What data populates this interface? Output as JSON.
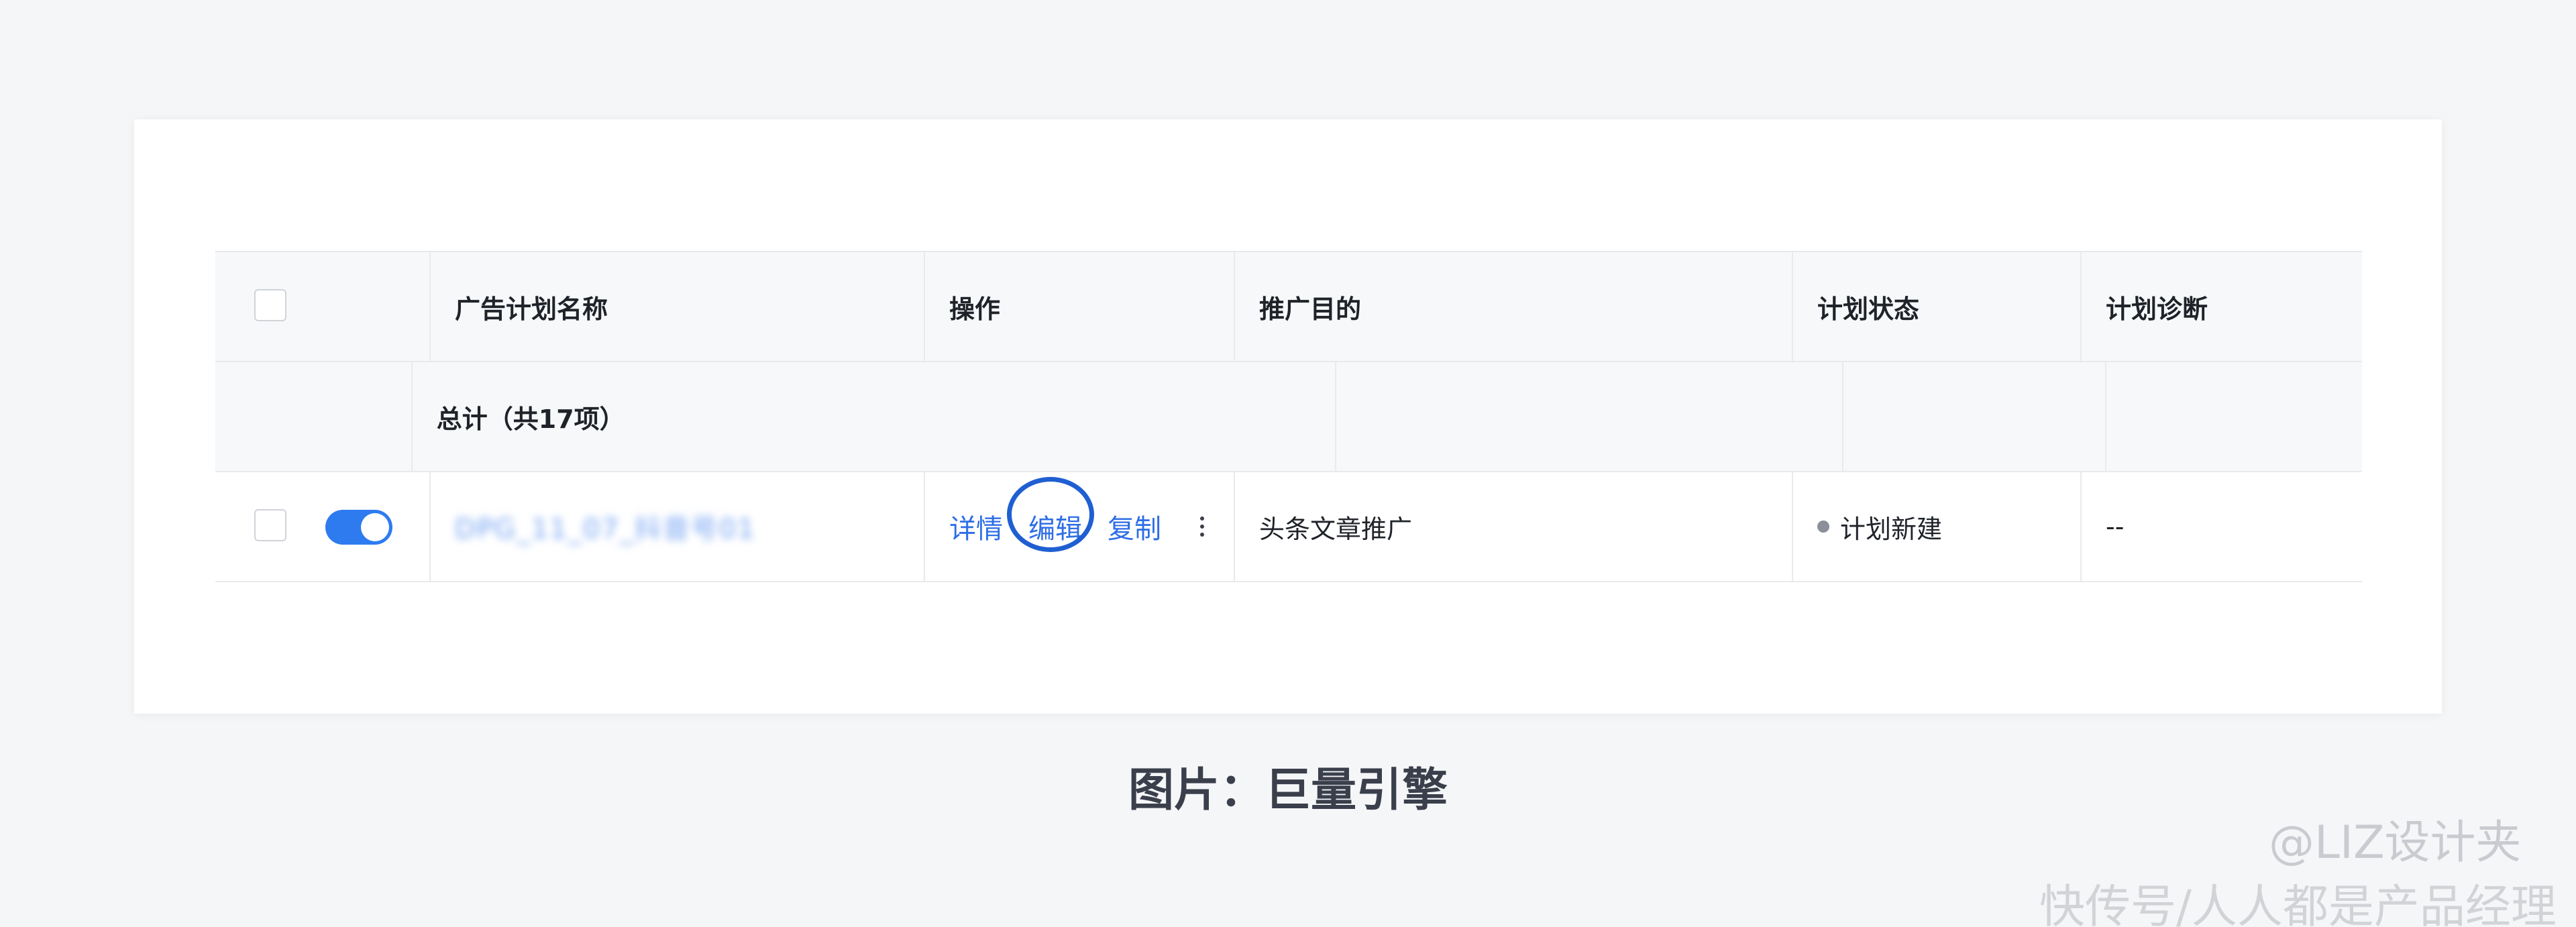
{
  "table": {
    "headers": [
      "广告计划名称",
      "操作",
      "推广目的",
      "计划状态",
      "计划诊断"
    ],
    "total_label": "总计（共17项）",
    "row": {
      "name": "DPG_11_07_抖音号01",
      "actions": [
        "详情",
        "编辑",
        "复制"
      ],
      "purpose": "头条文章推广",
      "status": "计划新建",
      "diagnosis": "--",
      "toggle_on": true
    }
  },
  "caption": "图片：巨量引擎",
  "watermark": {
    "line1": "@LIZ设计夹",
    "line2": "快传号/人人都是产品经理"
  },
  "colors": {
    "accent": "#2e7bf0",
    "link": "#2e6ee6",
    "highlight_circle": "#1f5fd1"
  }
}
